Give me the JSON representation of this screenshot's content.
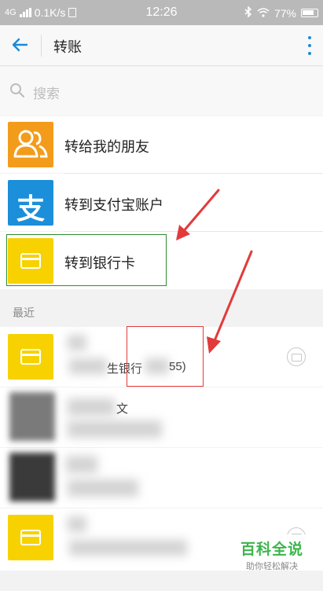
{
  "status_bar": {
    "network": "4G",
    "speed": "0.1K/s",
    "time": "12:26",
    "battery": "77%"
  },
  "header": {
    "title": "转账"
  },
  "search": {
    "placeholder": "搜索"
  },
  "menu": [
    {
      "label": "转给我的朋友",
      "icon": "friends-icon",
      "color": "#f39c1b"
    },
    {
      "label": "转到支付宝账户",
      "icon": "alipay-icon",
      "color": "#1b8fd9"
    },
    {
      "label": "转到银行卡",
      "icon": "bank-card-icon",
      "color": "#f7d200"
    }
  ],
  "recent": {
    "section_title": "最近",
    "items": [
      {
        "line2_bank": "生银行",
        "line2_tail": "55)"
      },
      {
        "line1_partial": "文"
      },
      {},
      {}
    ]
  },
  "watermark": {
    "main": "百科全说",
    "sub": "助你轻松解决"
  }
}
